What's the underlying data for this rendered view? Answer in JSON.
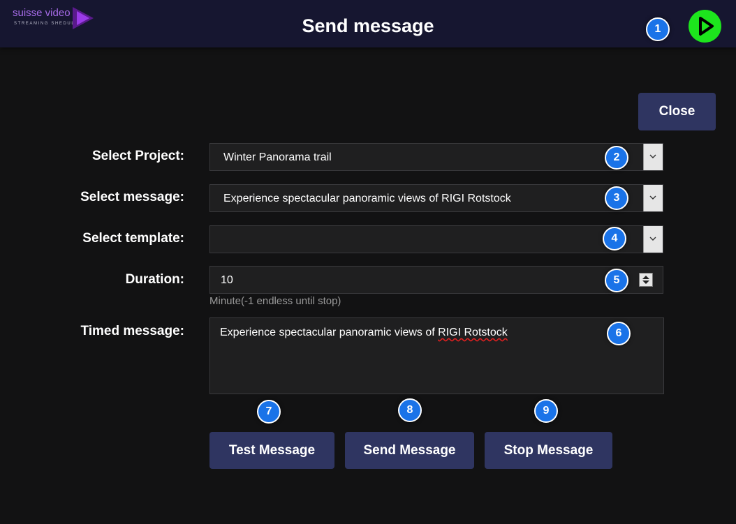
{
  "header": {
    "logo_text": "suisse video",
    "logo_subtitle": "STREAMING SHEDULER",
    "title": "Send message",
    "play_icon": "play-icon",
    "play_color": "#1de51d"
  },
  "badges": [
    "1",
    "2",
    "3",
    "4",
    "5",
    "6",
    "7",
    "8",
    "9"
  ],
  "close_label": "Close",
  "form": {
    "project_label": "Select Project:",
    "project_value": "Winter Panorama trail",
    "message_label": "Select message:",
    "message_value": "Experience spectacular panoramic views of RIGI Rotstock",
    "template_label": "Select template:",
    "template_value": "",
    "duration_label": "Duration:",
    "duration_value": "10",
    "duration_hint": "Minute(-1 endless until stop)",
    "timed_label": "Timed message:",
    "timed_text_prefix": "Experience spectacular panoramic views of ",
    "timed_text_misspelled": "RIGI Rotstock"
  },
  "buttons": {
    "test": "Test Message",
    "send": "Send Message",
    "stop": "Stop Message"
  },
  "colors": {
    "accent_button": "#2f3561",
    "badge": "#1a73e8",
    "background": "#121213",
    "header": "#161630"
  }
}
